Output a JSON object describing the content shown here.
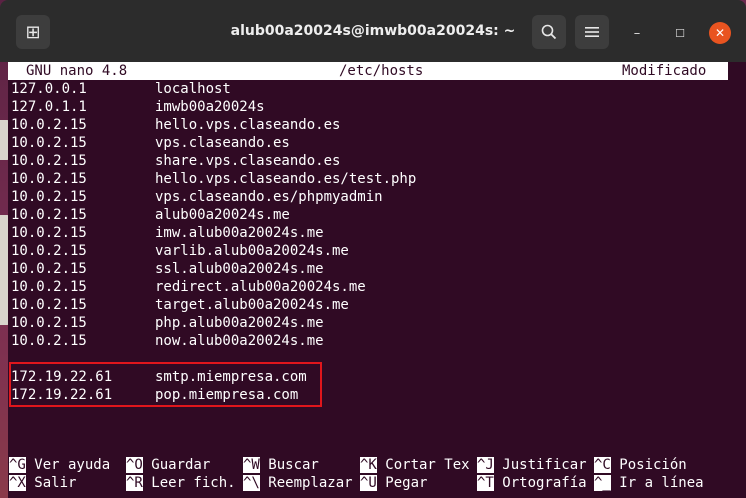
{
  "window": {
    "title": "alub00a20024s@imwb00a20024s: ~",
    "icons": {
      "new_tab": "new-tab-icon",
      "search": "search-icon",
      "menu": "hamburger-menu-icon",
      "minimize": "minimize-icon",
      "maximize": "maximize-icon",
      "close": "close-icon"
    },
    "glyphs": {
      "new_tab": "⊞",
      "minimize": "–",
      "maximize": "☐",
      "close": "✕"
    },
    "colors": {
      "titlebar": "#2c2c2c",
      "terminal_bg": "#300a24",
      "close": "#e95420",
      "highlight_box": "#e0161c"
    }
  },
  "nano": {
    "version": "GNU nano 4.8",
    "filename": "/etc/hosts",
    "status": "Modificado"
  },
  "hosts": [
    {
      "ip": "127.0.0.1",
      "host": "localhost"
    },
    {
      "ip": "127.0.1.1",
      "host": "imwb00a20024s"
    },
    {
      "ip": "10.0.2.15",
      "host": "hello.vps.claseando.es"
    },
    {
      "ip": "10.0.2.15",
      "host": "vps.claseando.es"
    },
    {
      "ip": "10.0.2.15",
      "host": "share.vps.claseando.es"
    },
    {
      "ip": "10.0.2.15",
      "host": "hello.vps.claseando.es/test.php"
    },
    {
      "ip": "10.0.2.15",
      "host": "vps.claseando.es/phpmyadmin"
    },
    {
      "ip": "10.0.2.15",
      "host": "alub00a20024s.me"
    },
    {
      "ip": "10.0.2.15",
      "host": "imw.alub00a20024s.me"
    },
    {
      "ip": "10.0.2.15",
      "host": "varlib.alub00a20024s.me"
    },
    {
      "ip": "10.0.2.15",
      "host": "ssl.alub00a20024s.me"
    },
    {
      "ip": "10.0.2.15",
      "host": "redirect.alub00a20024s.me"
    },
    {
      "ip": "10.0.2.15",
      "host": "target.alub00a20024s.me"
    },
    {
      "ip": "10.0.2.15",
      "host": "php.alub00a20024s.me"
    },
    {
      "ip": "10.0.2.15",
      "host": "now.alub00a20024s.me"
    },
    {
      "ip": "",
      "host": ""
    },
    {
      "ip": "172.19.22.61",
      "host": "smtp.miempresa.com"
    },
    {
      "ip": "172.19.22.61",
      "host": "pop.miempresa.com"
    }
  ],
  "shortcuts": {
    "row1": [
      {
        "key": "^G",
        "label": " Ver ayuda"
      },
      {
        "key": "^O",
        "label": " Guardar"
      },
      {
        "key": "^W",
        "label": " Buscar"
      },
      {
        "key": "^K",
        "label": " Cortar Tex"
      },
      {
        "key": "^J",
        "label": " Justificar"
      },
      {
        "key": "^C",
        "label": " Posición"
      }
    ],
    "row2": [
      {
        "key": "^X",
        "label": " Salir"
      },
      {
        "key": "^R",
        "label": " Leer fich."
      },
      {
        "key": "^\\",
        "label": " Reemplazar"
      },
      {
        "key": "^U",
        "label": " Pegar"
      },
      {
        "key": "^T",
        "label": " Ortografía"
      },
      {
        "key": "^_",
        "label": " Ir a línea"
      }
    ]
  }
}
